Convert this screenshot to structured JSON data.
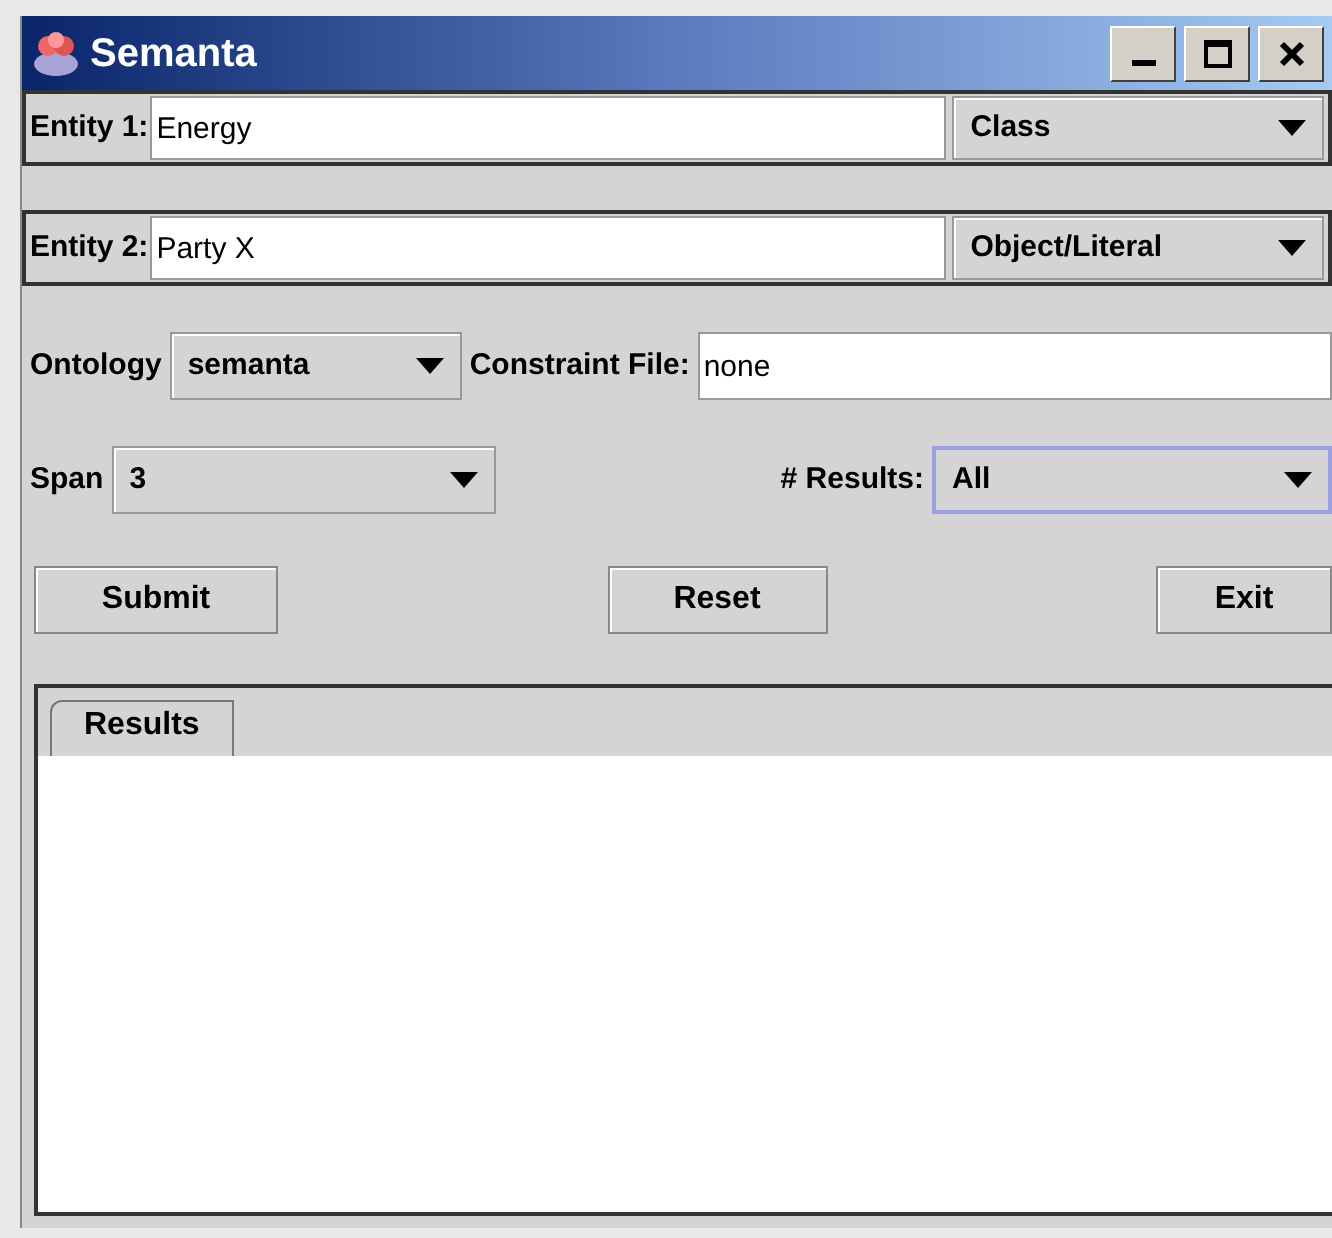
{
  "window": {
    "title": "Semanta"
  },
  "entities": [
    {
      "label": "Entity 1:",
      "value": "Energy",
      "type": "Class"
    },
    {
      "label": "Entity 2:",
      "value": "Party X",
      "type": "Object/Literal"
    }
  ],
  "ontology": {
    "label": "Ontology",
    "value": "semanta"
  },
  "constraint_file": {
    "label": "Constraint File:",
    "value": "none"
  },
  "span": {
    "label": "Span",
    "value": "3"
  },
  "results_count": {
    "label": "# Results:",
    "value": "All",
    "focused": true
  },
  "buttons": [
    "Submit",
    "Reset",
    "Exit"
  ],
  "tabs": [
    {
      "label": "Results",
      "selected": true
    }
  ]
}
